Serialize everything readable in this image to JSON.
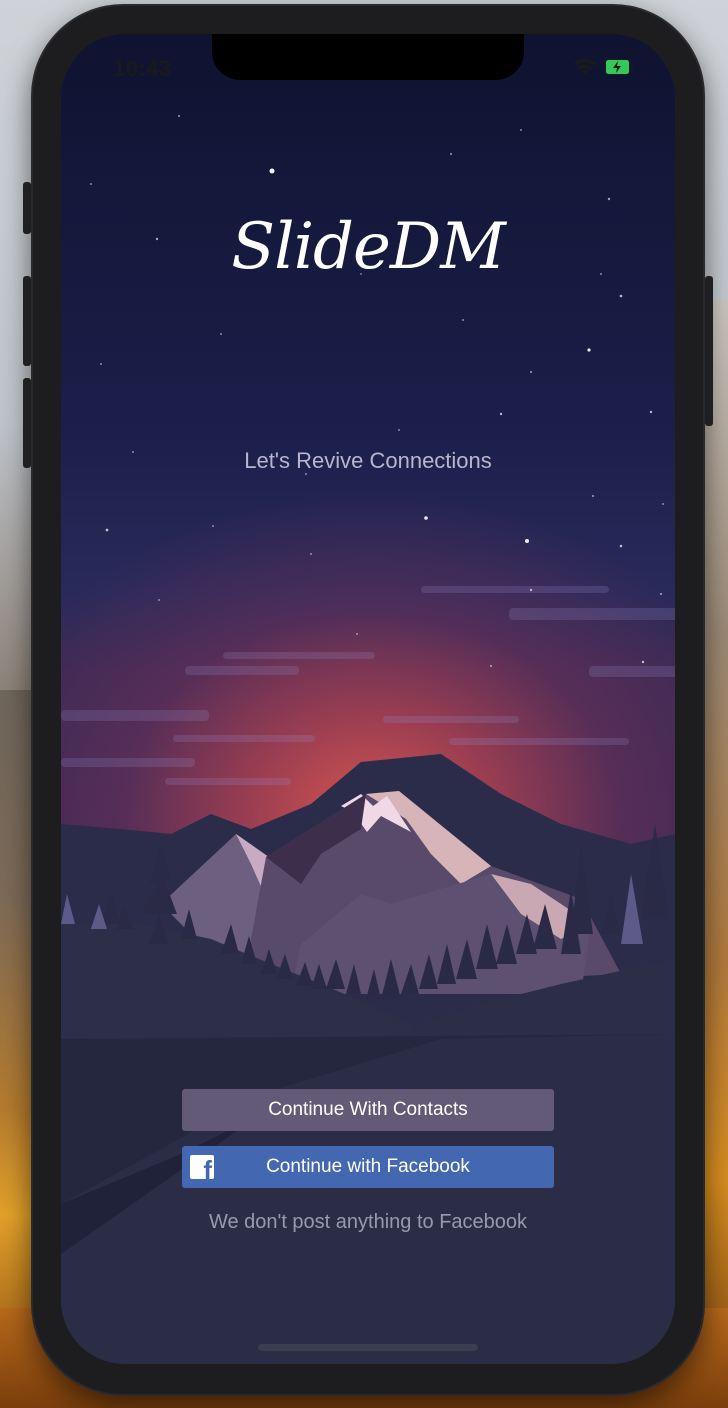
{
  "status_bar": {
    "time": "10:43"
  },
  "app": {
    "logo": "SlideDM",
    "tagline": "Let's Revive Connections"
  },
  "actions": {
    "contacts_label": "Continue With Contacts",
    "facebook_label": "Continue with Facebook",
    "facebook_icon": "facebook-icon"
  },
  "disclaimer": "We don't post anything to Facebook",
  "colors": {
    "contacts_button": "#625a77",
    "facebook_button": "#4367b0",
    "battery": "#34c759"
  }
}
